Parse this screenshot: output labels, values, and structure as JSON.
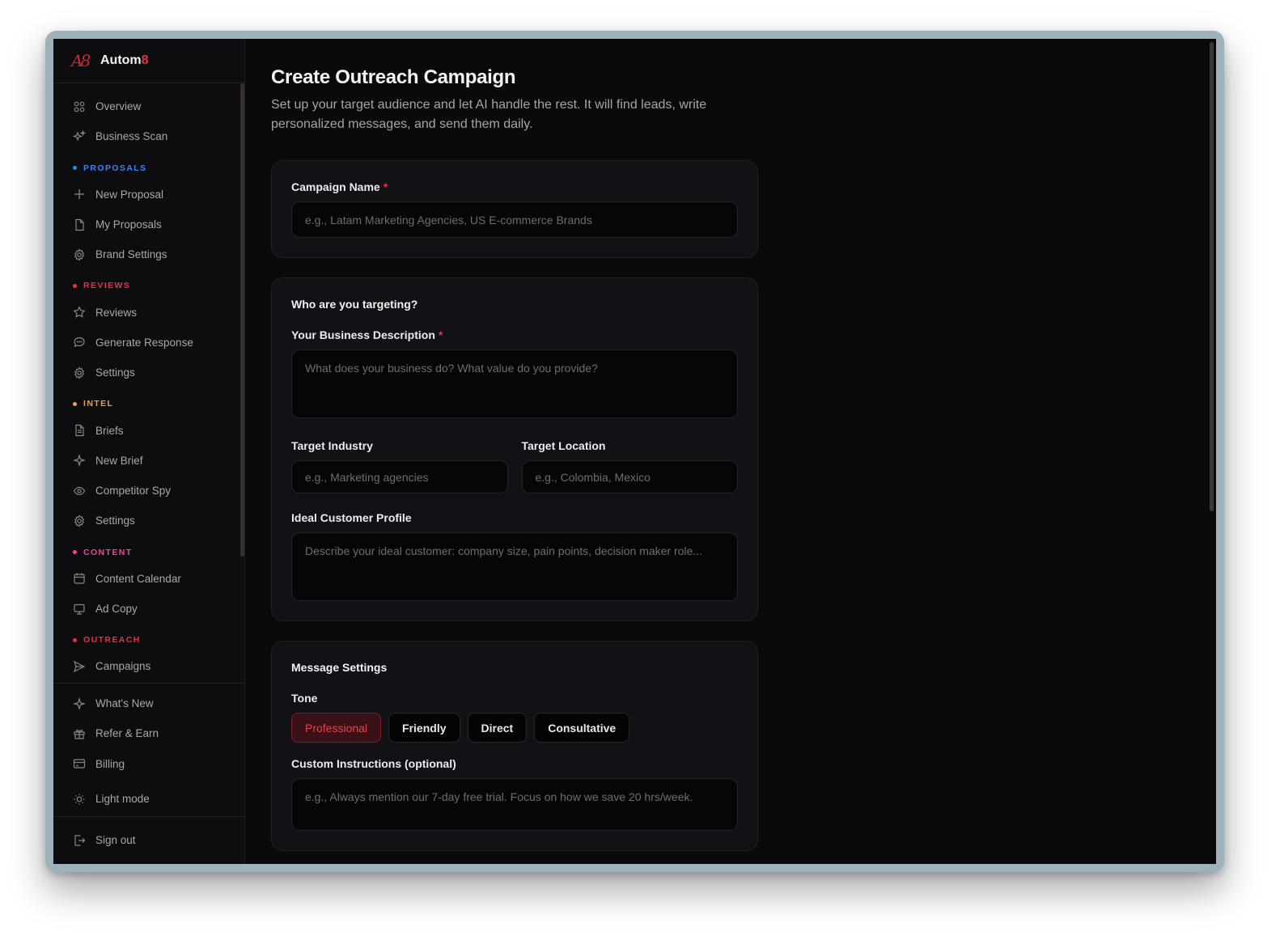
{
  "brand": {
    "logo": "A8",
    "name_prefix": "Autom",
    "name_suffix": "8"
  },
  "sidebar": {
    "top_items": [
      {
        "label": "Overview",
        "icon": "grid-icon"
      },
      {
        "label": "Business Scan",
        "icon": "sparkles-icon"
      }
    ],
    "sections": [
      {
        "label": "PROPOSALS",
        "color": "#3b82f6",
        "items": [
          {
            "label": "New Proposal",
            "icon": "plus-icon"
          },
          {
            "label": "My Proposals",
            "icon": "file-icon"
          },
          {
            "label": "Brand Settings",
            "icon": "gear-icon"
          }
        ]
      },
      {
        "label": "REVIEWS",
        "color": "#e03448",
        "items": [
          {
            "label": "Reviews",
            "icon": "star-icon"
          },
          {
            "label": "Generate Response",
            "icon": "chat-icon"
          },
          {
            "label": "Settings",
            "icon": "gear-icon"
          }
        ]
      },
      {
        "label": "INTEL",
        "color": "#e8a24a",
        "items": [
          {
            "label": "Briefs",
            "icon": "file-text-icon"
          },
          {
            "label": "New Brief",
            "icon": "sparkle-icon"
          },
          {
            "label": "Competitor Spy",
            "icon": "eye-icon"
          },
          {
            "label": "Settings",
            "icon": "gear-icon"
          }
        ]
      },
      {
        "label": "CONTENT",
        "color": "#ec4899",
        "items": [
          {
            "label": "Content Calendar",
            "icon": "calendar-icon"
          },
          {
            "label": "Ad Copy",
            "icon": "monitor-icon"
          }
        ]
      },
      {
        "label": "OUTREACH",
        "color": "#e03448",
        "items": [
          {
            "label": "Campaigns",
            "icon": "send-icon"
          }
        ]
      }
    ],
    "footer_items": [
      {
        "label": "What's New",
        "icon": "sparkle-icon"
      },
      {
        "label": "Refer & Earn",
        "icon": "gift-icon"
      },
      {
        "label": "Billing",
        "icon": "credit-card-icon"
      },
      {
        "label": "Light mode",
        "icon": "sun-icon"
      }
    ],
    "signout": {
      "label": "Sign out",
      "icon": "logout-icon"
    }
  },
  "page": {
    "title": "Create Outreach Campaign",
    "subtitle": "Set up your target audience and let AI handle the rest. It will find leads, write personalized messages, and send them daily."
  },
  "campaign_card": {
    "name_label": "Campaign Name",
    "required_mark": "*",
    "name_placeholder": "e.g., Latam Marketing Agencies, US E-commerce Brands",
    "name_value": ""
  },
  "targeting_card": {
    "title": "Who are you targeting?",
    "business_label": "Your Business Description",
    "required_mark": "*",
    "business_placeholder": "What does your business do? What value do you provide?",
    "industry_label": "Target Industry",
    "industry_placeholder": "e.g., Marketing agencies",
    "location_label": "Target Location",
    "location_placeholder": "e.g., Colombia, Mexico",
    "icp_label": "Ideal Customer Profile",
    "icp_placeholder": "Describe your ideal customer: company size, pain points, decision maker role..."
  },
  "message_card": {
    "title": "Message Settings",
    "tone_label": "Tone",
    "tones": [
      "Professional",
      "Friendly",
      "Direct",
      "Consultative"
    ],
    "selected_tone": "Professional",
    "custom_label": "Custom Instructions (optional)",
    "custom_placeholder": "e.g., Always mention our 7-day free trial. Focus on how we save 20 hrs/week."
  }
}
